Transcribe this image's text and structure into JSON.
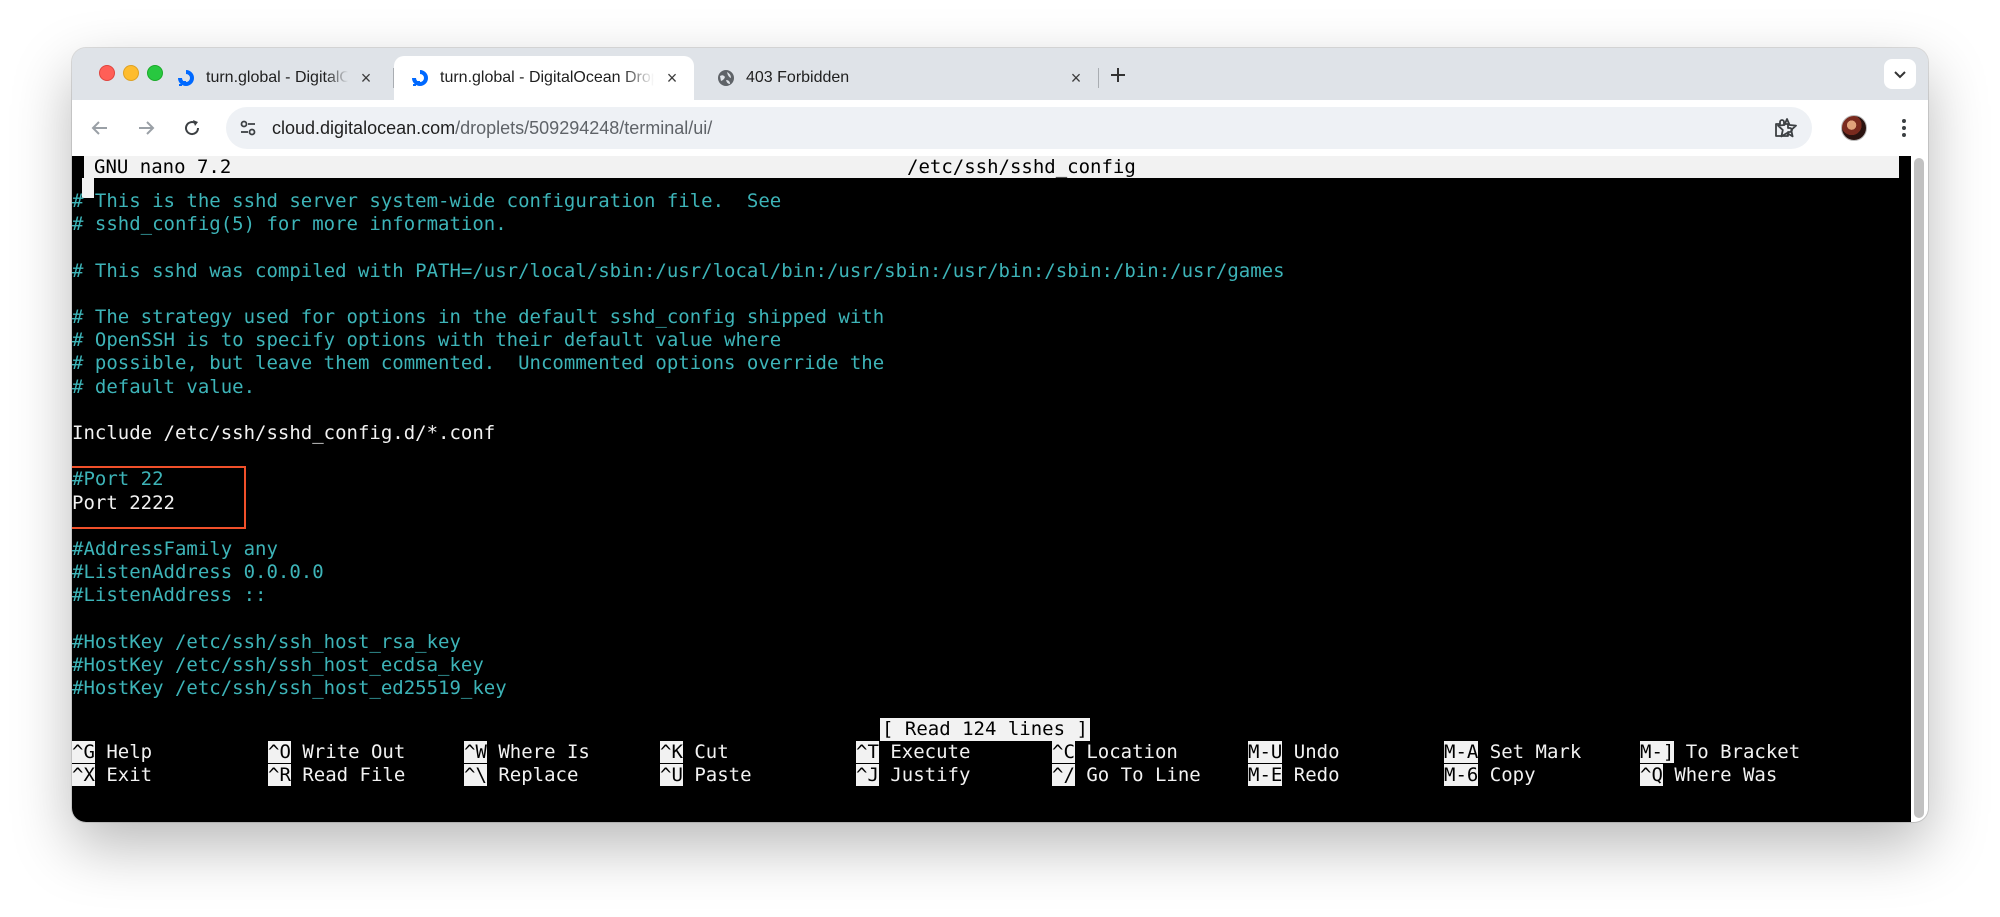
{
  "browser": {
    "tabs": [
      {
        "title": "turn.global - DigitalOcean",
        "icon": "digitalocean-icon",
        "active": false
      },
      {
        "title": "turn.global - DigitalOcean Droplet",
        "icon": "digitalocean-icon",
        "active": true
      },
      {
        "title": "403 Forbidden",
        "icon": "globe-icon",
        "active": false
      }
    ],
    "url_host": "cloud.digitalocean.com",
    "url_path": "/droplets/509294248/terminal/ui/",
    "accent_color": "#0069ff"
  },
  "nano": {
    "version": "GNU nano 7.2",
    "filename": "/etc/ssh/sshd_config",
    "lines": [
      {
        "text": "# This is the sshd server system-wide configuration file.  See",
        "kind": "comment"
      },
      {
        "text": "# sshd_config(5) for more information.",
        "kind": "comment"
      },
      {
        "text": "",
        "kind": "plain"
      },
      {
        "text": "# This sshd was compiled with PATH=/usr/local/sbin:/usr/local/bin:/usr/sbin:/usr/bin:/sbin:/bin:/usr/games",
        "kind": "comment"
      },
      {
        "text": "",
        "kind": "plain"
      },
      {
        "text": "# The strategy used for options in the default sshd_config shipped with",
        "kind": "comment"
      },
      {
        "text": "# OpenSSH is to specify options with their default value where",
        "kind": "comment"
      },
      {
        "text": "# possible, but leave them commented.  Uncommented options override the",
        "kind": "comment"
      },
      {
        "text": "# default value.",
        "kind": "comment"
      },
      {
        "text": "",
        "kind": "plain"
      },
      {
        "text": "Include /etc/ssh/sshd_config.d/*.conf",
        "kind": "plain"
      },
      {
        "text": "",
        "kind": "plain"
      },
      {
        "text": "#Port 22",
        "kind": "comment"
      },
      {
        "text": "Port 2222",
        "kind": "plain"
      },
      {
        "text": "",
        "kind": "plain"
      },
      {
        "text": "#AddressFamily any",
        "kind": "comment"
      },
      {
        "text": "#ListenAddress 0.0.0.0",
        "kind": "comment"
      },
      {
        "text": "#ListenAddress ::",
        "kind": "comment"
      },
      {
        "text": "",
        "kind": "plain"
      },
      {
        "text": "#HostKey /etc/ssh/ssh_host_rsa_key",
        "kind": "comment"
      },
      {
        "text": "#HostKey /etc/ssh/ssh_host_ecdsa_key",
        "kind": "comment"
      },
      {
        "text": "#HostKey /etc/ssh/ssh_host_ed25519_key",
        "kind": "comment"
      }
    ],
    "status_message": "[ Read 124 lines ]",
    "shortcuts": [
      {
        "key": "^G",
        "label": "Help"
      },
      {
        "key": "^X",
        "label": "Exit"
      },
      {
        "key": "^O",
        "label": "Write Out"
      },
      {
        "key": "^R",
        "label": "Read File"
      },
      {
        "key": "^W",
        "label": "Where Is"
      },
      {
        "key": "^\\",
        "label": "Replace"
      },
      {
        "key": "^K",
        "label": "Cut"
      },
      {
        "key": "^U",
        "label": "Paste"
      },
      {
        "key": "^T",
        "label": "Execute"
      },
      {
        "key": "^J",
        "label": "Justify"
      },
      {
        "key": "^C",
        "label": "Location"
      },
      {
        "key": "^/",
        "label": "Go To Line"
      },
      {
        "key": "M-U",
        "label": "Undo"
      },
      {
        "key": "M-E",
        "label": "Redo"
      },
      {
        "key": "M-A",
        "label": "Set Mark"
      },
      {
        "key": "M-6",
        "label": "Copy"
      },
      {
        "key": "M-]",
        "label": "To Bracket"
      },
      {
        "key": "^Q",
        "label": "Where Was"
      }
    ],
    "comment_color": "#3db4b8",
    "highlight_color": "#f0502a"
  }
}
